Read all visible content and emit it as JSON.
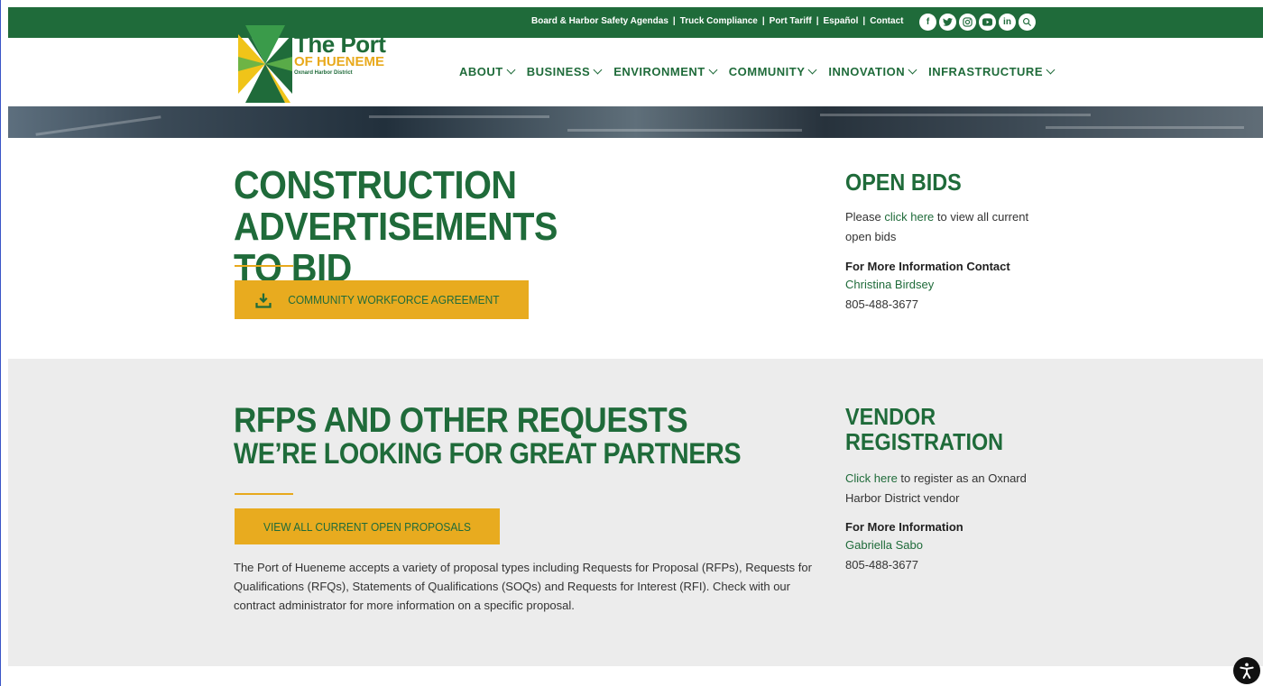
{
  "topbar": {
    "links": [
      "Board & Harbor Safety Agendas",
      "Truck Compliance",
      "Port Tariff",
      "Español",
      "Contact"
    ],
    "separator": "|",
    "social_icons": [
      "facebook-icon",
      "twitter-icon",
      "instagram-icon",
      "youtube-icon",
      "linkedin-icon",
      "search-icon"
    ]
  },
  "logo": {
    "title": "The Port",
    "subtitle": "OF HUENEME",
    "tagline": "Oxnard Harbor District"
  },
  "nav": {
    "items": [
      "ABOUT",
      "BUSINESS",
      "ENVIRONMENT",
      "COMMUNITY",
      "INNOVATION",
      "INFRASTRUCTURE"
    ]
  },
  "construction": {
    "heading_line1": "CONSTRUCTION ADVERTISEMENTS",
    "heading_line2": "TO BID",
    "button_label": "COMMUNITY WORKFORCE AGREEMENT"
  },
  "open_bids": {
    "heading": "OPEN BIDS",
    "text_before": "Please ",
    "link": "click here",
    "text_after": " to view all current open bids",
    "contact_heading": "For More Information Contact",
    "contact_name": "Christina Birdsey",
    "contact_phone": "805-488-3677"
  },
  "rfps": {
    "heading_line1": "RFPS AND OTHER REQUESTS",
    "heading_line2": "WE’RE LOOKING FOR GREAT PARTNERS",
    "button_label": "VIEW ALL CURRENT OPEN PROPOSALS",
    "body": "The Port of Hueneme accepts a variety of proposal types including Requests for Proposal (RFPs), Requests for Qualifications (RFQs), Statements of Qualifications (SOQs) and Requests for Interest (RFI). Check with our contract administrator for more information on a specific proposal."
  },
  "vendor": {
    "heading_line1": "VENDOR",
    "heading_line2": "REGISTRATION",
    "link": "Click here",
    "text_after": " to register as an Oxnard Harbor District vendor",
    "contact_heading": "For More Information",
    "contact_name": "Gabriella Sabo",
    "contact_phone": "805-488-3677"
  },
  "colors": {
    "brand_green": "#1f6b3a",
    "brand_gold": "#e8ab1f",
    "section_gray": "#ececec"
  }
}
